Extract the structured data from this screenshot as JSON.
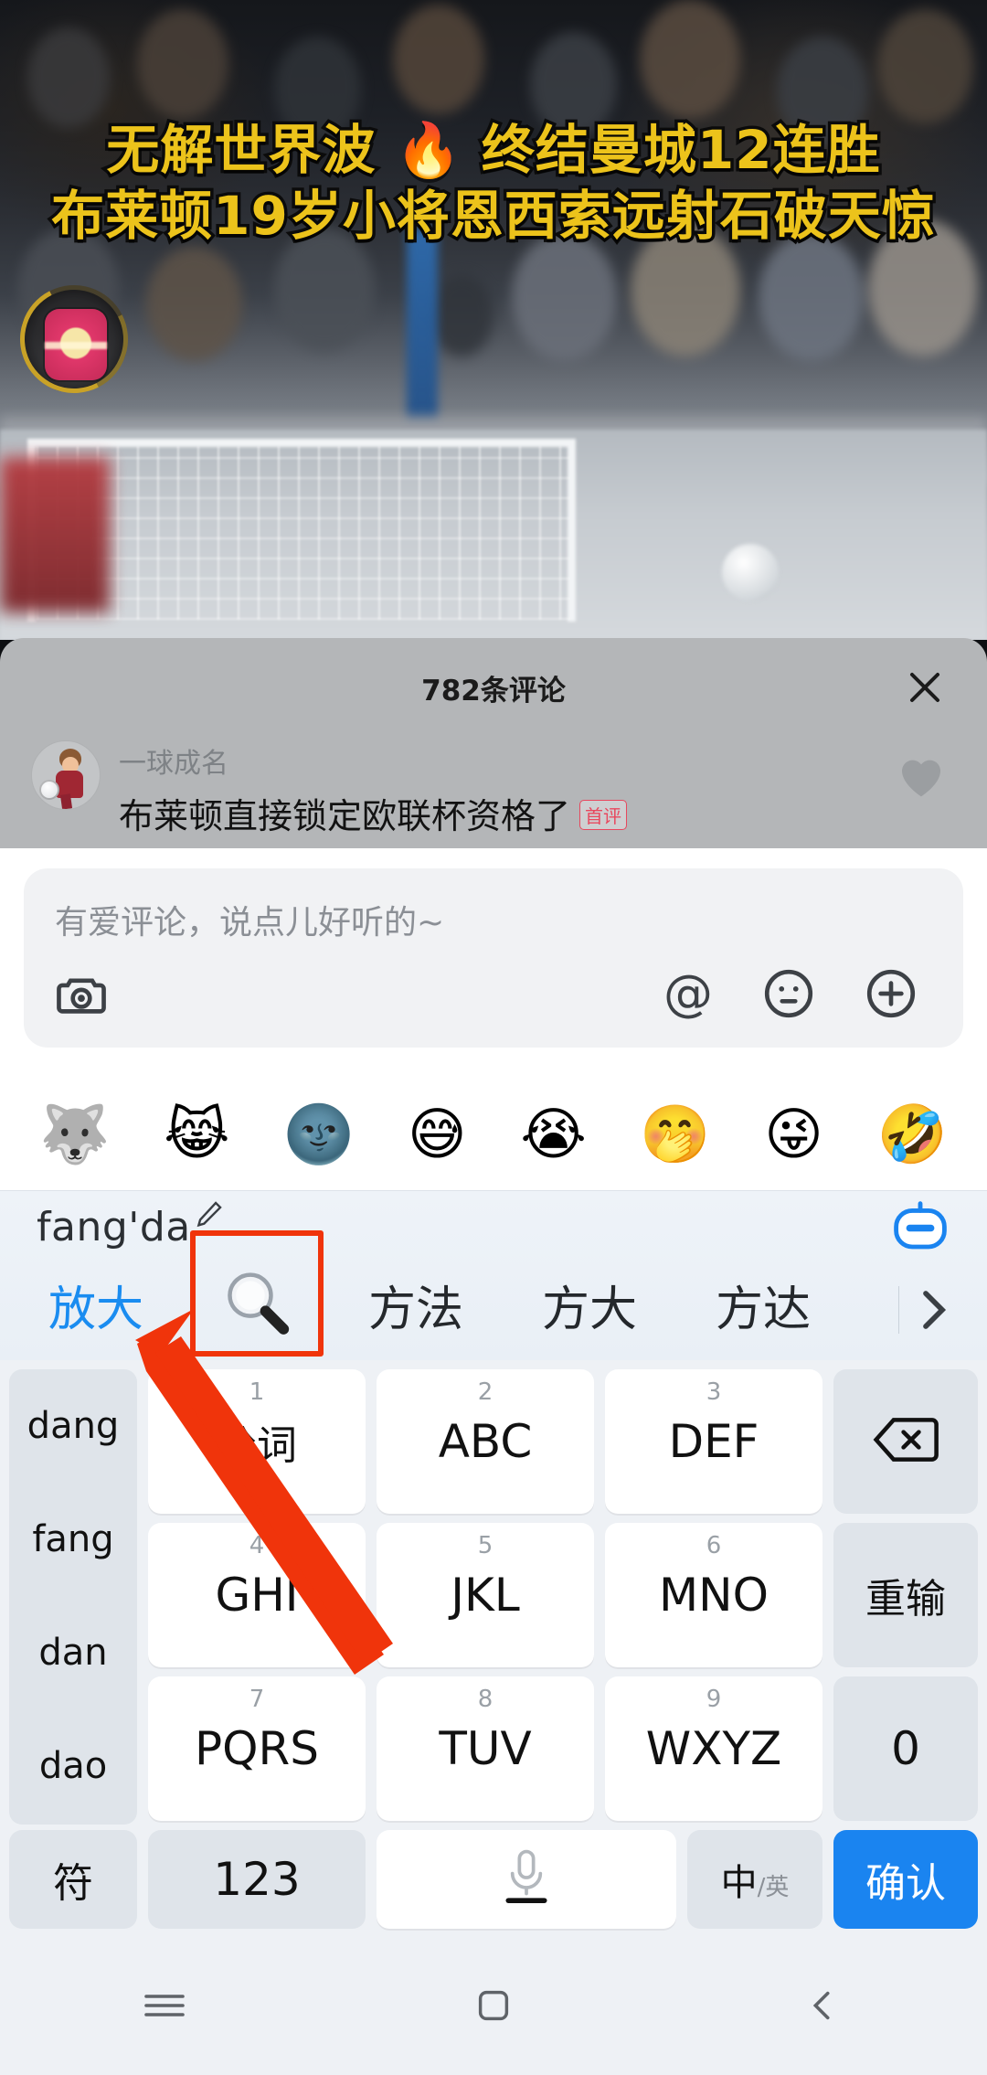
{
  "video": {
    "title_line1": "无解世界波 🔥 终结曼城12连胜",
    "title_line2": "布莱顿19岁小将恩西索远射石破天惊",
    "avatar_name": "avatar"
  },
  "comment_sheet": {
    "title": "782条评论",
    "close_icon": "close-icon",
    "comment": {
      "author": "一球成名",
      "text": "布莱顿直接锁定欧联杯资格了",
      "badge": "首评",
      "like_icon": "heart-icon"
    }
  },
  "input_panel": {
    "placeholder": "有爱评论，说点儿好听的~",
    "value": "",
    "icons": {
      "camera": "camera-icon",
      "mention": "@",
      "emoji": "emoji-face-icon",
      "plus": "plus-circle-icon"
    }
  },
  "emoji_strip": {
    "items": [
      "🐺",
      "😹",
      "🌚",
      "😅",
      "😭",
      "🤭",
      "😜",
      "🤣"
    ]
  },
  "ime": {
    "pinyin": "fang'da",
    "pencil_icon": "pencil-icon",
    "robot_icon": "robot-icon",
    "candidates": [
      {
        "label": "放大",
        "active": true
      },
      {
        "label": "",
        "icon": "magnifier-icon",
        "highlighted": true
      },
      {
        "label": "方法",
        "active": false
      },
      {
        "label": "方大",
        "active": false
      },
      {
        "label": "方达",
        "active": false
      }
    ],
    "more_icon": "chevron-right-icon"
  },
  "keyboard": {
    "pinyin_options": [
      "dang",
      "fang",
      "dan",
      "dao"
    ],
    "keys": [
      {
        "num": "1",
        "label": "分词",
        "style": "white",
        "cn": true
      },
      {
        "num": "2",
        "label": "ABC",
        "style": "white",
        "cn": false
      },
      {
        "num": "3",
        "label": "DEF",
        "style": "white",
        "cn": false
      },
      {
        "num": "4",
        "label": "GHI",
        "style": "white",
        "cn": false
      },
      {
        "num": "5",
        "label": "JKL",
        "style": "white",
        "cn": false
      },
      {
        "num": "6",
        "label": "MNO",
        "style": "white",
        "cn": false
      },
      {
        "num": "7",
        "label": "PQRS",
        "style": "white",
        "cn": false
      },
      {
        "num": "8",
        "label": "TUV",
        "style": "white",
        "cn": false
      },
      {
        "num": "9",
        "label": "WXYZ",
        "style": "white",
        "cn": false
      }
    ],
    "right_column": [
      {
        "label": "",
        "icon": "backspace-icon",
        "style": "grey"
      },
      {
        "label": "重输",
        "style": "grey",
        "cn": true
      },
      {
        "label": "0",
        "style": "grey",
        "cn": false
      }
    ],
    "bottom_row": {
      "symbol": "符",
      "numbers": "123",
      "space_icon": "microphone-icon",
      "lang_main": "中",
      "lang_sub": "/英",
      "confirm": "确认"
    }
  },
  "navbar": {
    "menu_icon": "menu-icon",
    "home_icon": "home-square-icon",
    "back_icon": "back-chevron-icon"
  },
  "annotation": {
    "highlight_color": "#f0340b",
    "arrow_color": "#f0340b"
  }
}
